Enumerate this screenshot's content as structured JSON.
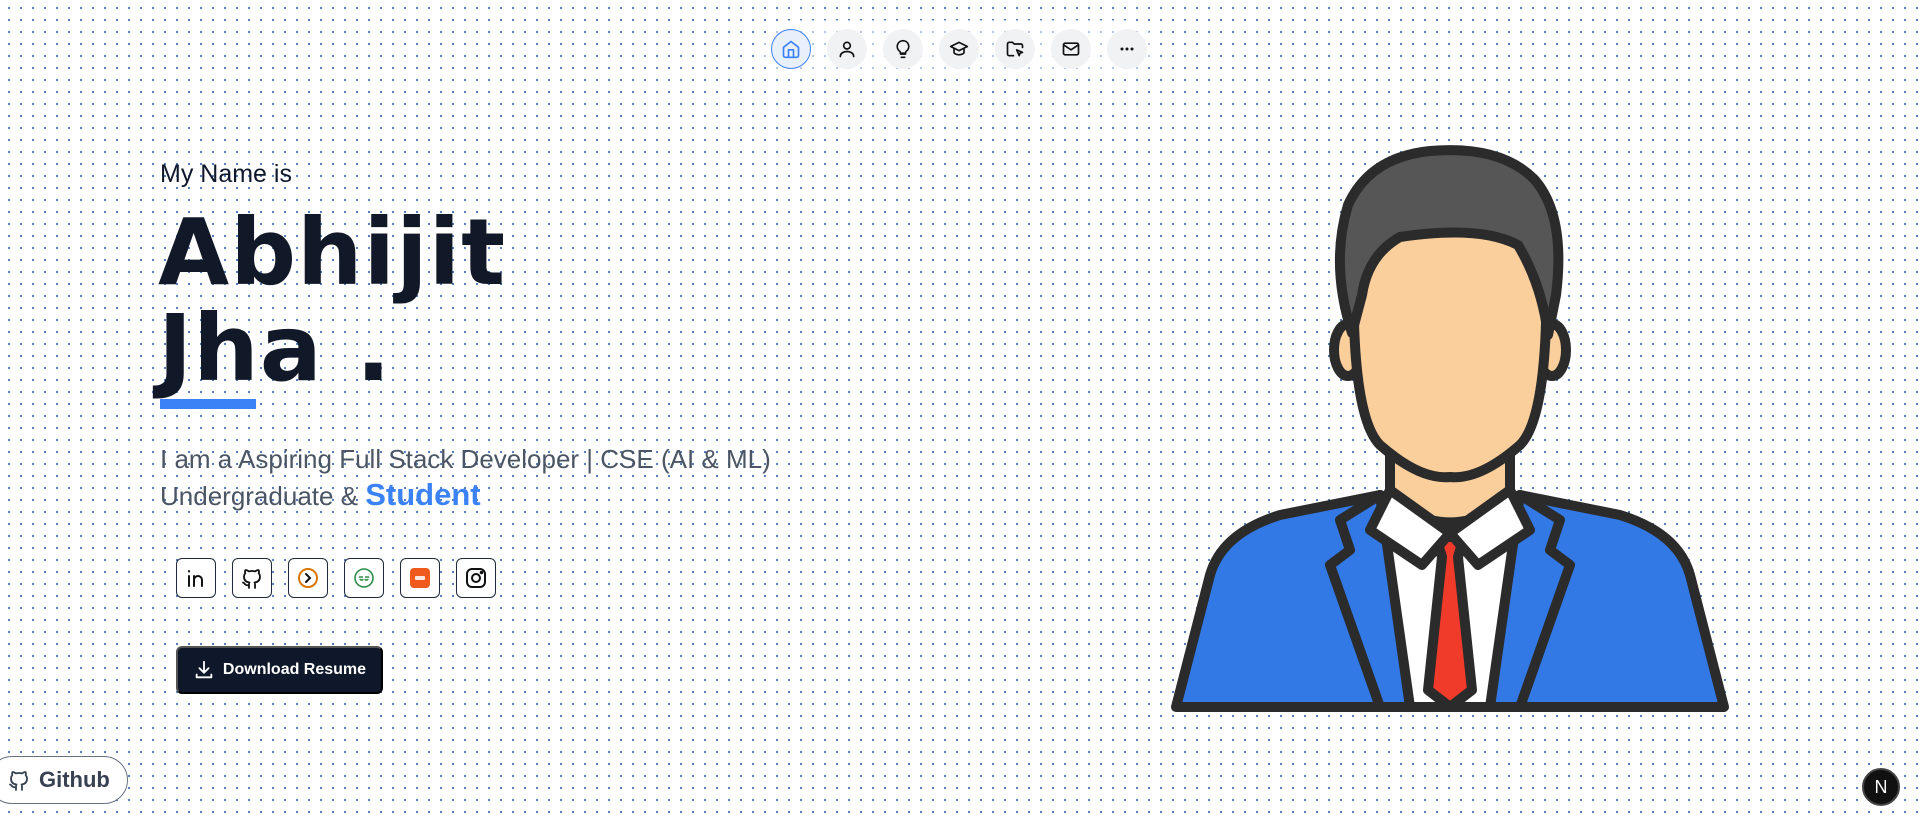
{
  "nav": {
    "items": [
      {
        "icon": "home-icon",
        "active": true
      },
      {
        "icon": "user-icon",
        "active": false
      },
      {
        "icon": "lightbulb-icon",
        "active": false
      },
      {
        "icon": "graduation-cap-icon",
        "active": false
      },
      {
        "icon": "folder-cursor-icon",
        "active": false
      },
      {
        "icon": "mail-icon",
        "active": false
      },
      {
        "icon": "more-icon",
        "active": false
      }
    ]
  },
  "hero": {
    "intro": "My Name is",
    "name_first": "Abhijit",
    "name_last": "Jha .",
    "tagline_main": "I am a Aspiring Full Stack Developer | CSE (AI & ML) Undergraduate & ",
    "tagline_accent": "Student"
  },
  "socials": [
    {
      "icon": "linkedin-icon"
    },
    {
      "icon": "github-icon"
    },
    {
      "icon": "codechef-icon"
    },
    {
      "icon": "geeksforgeeks-icon"
    },
    {
      "icon": "leetcode-icon"
    },
    {
      "icon": "instagram-icon"
    }
  ],
  "resume_button": {
    "label": "Download Resume"
  },
  "github_pill": {
    "label": "Github"
  },
  "badge": {
    "label": "N"
  },
  "colors": {
    "accent": "#3b82f6",
    "dark": "#0f172a",
    "dots": "#4f78b8"
  }
}
